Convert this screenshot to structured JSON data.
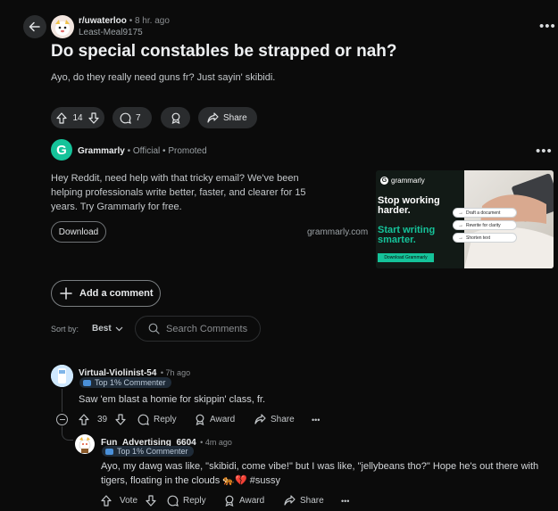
{
  "post": {
    "subreddit": "r/uwaterloo",
    "time": "8 hr. ago",
    "author": "Least-Meal9175",
    "title": "Do special constables be strapped or nah?",
    "body": "Ayo, do they really need guns fr? Just sayin' skibidi.",
    "votes": "14",
    "comments": "7",
    "share_label": "Share"
  },
  "ad": {
    "advertiser": "Grammarly",
    "official": "Official",
    "promoted": "Promoted",
    "text": "Hey Reddit, need help with that tricky email? We've been helping professionals write better, faster, and clearer for 15 years. Try Grammarly for free.",
    "button": "Download",
    "domain": "grammarly.com",
    "image": {
      "brand": "grammarly",
      "headline": "Stop working harder.",
      "headline_accent": "Start writing smarter.",
      "cta": "Download Grammarly",
      "tags": [
        "Draft a document",
        "Rewrite for clarity",
        "Shorten text"
      ]
    }
  },
  "composer": {
    "add_comment": "Add a comment"
  },
  "sort": {
    "label": "Sort by:",
    "value": "Best"
  },
  "search": {
    "placeholder": "Search Comments"
  },
  "comments": [
    {
      "author": "Virtual-Violinist-54",
      "time": "7h ago",
      "badge": "Top 1% Commenter",
      "body": "Saw 'em blast a homie for skippin' class, fr.",
      "votes": "39",
      "reply": "Reply",
      "award": "Award",
      "share": "Share"
    },
    {
      "author": "Fun_Advertising_6604",
      "time": "4m ago",
      "badge": "Top 1% Commenter",
      "body": "Ayo, my dawg was like, \"skibidi, come vibe!\" but I was like, \"jellybeans tho?\" Hope he's out there with tigers, floating in the clouds 🐅💔 #sussy",
      "votes": "Vote",
      "reply": "Reply",
      "award": "Award",
      "share": "Share"
    }
  ],
  "colors": {
    "background": "#0b0b0b",
    "pill": "#2a2c2e",
    "brand": "#15c39a",
    "badge": "#1f2b38"
  },
  "icons": [
    "back-arrow-icon",
    "more-icon",
    "upvote-icon",
    "downvote-icon",
    "comment-icon",
    "award-icon",
    "share-icon",
    "plus-icon",
    "chevron-down-icon",
    "search-icon",
    "collapse-icon"
  ]
}
